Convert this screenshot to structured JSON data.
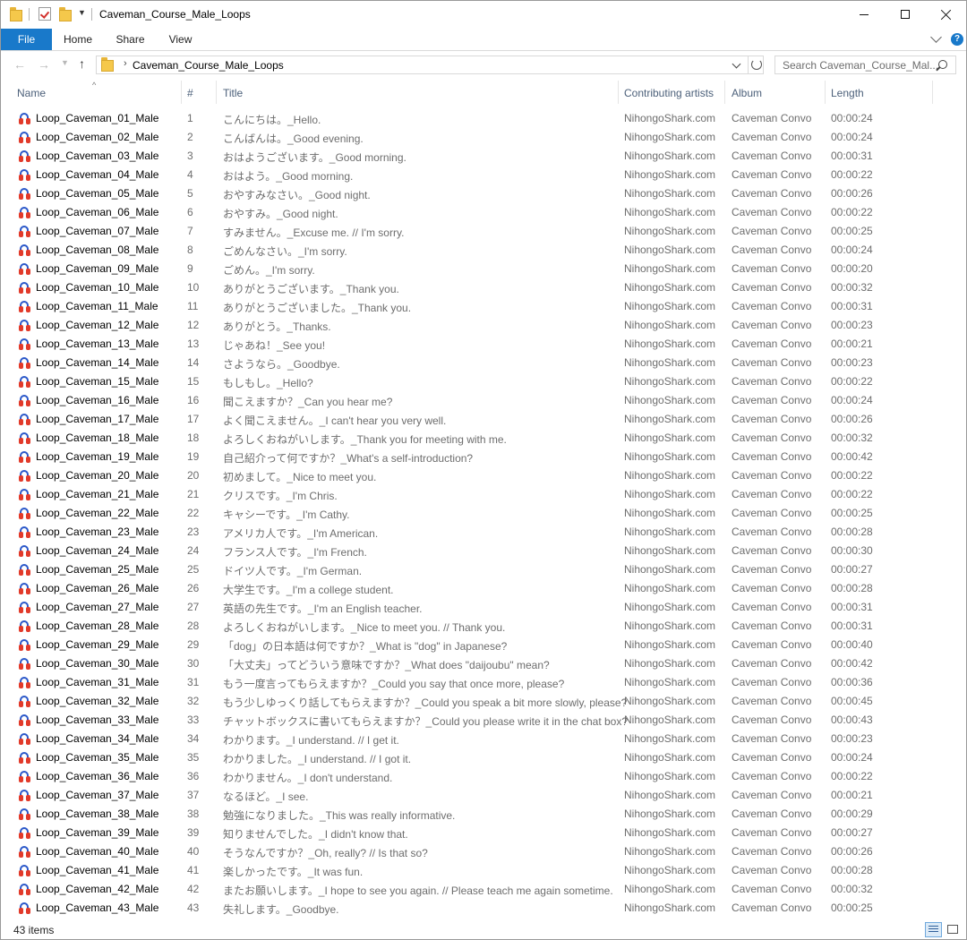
{
  "window": {
    "title": "Caveman_Course_Male_Loops"
  },
  "ribbon": {
    "tabs": [
      "File",
      "Home",
      "Share",
      "View"
    ]
  },
  "address": {
    "path": "Caveman_Course_Male_Loops",
    "search_placeholder": "Search Caveman_Course_Mal..."
  },
  "columns": {
    "name": "Name",
    "number": "#",
    "title": "Title",
    "artists": "Contributing artists",
    "album": "Album",
    "length": "Length"
  },
  "files": [
    {
      "name": "Loop_Caveman_01_Male",
      "num": "1",
      "title": "こんにちは。_Hello.",
      "artist": "NihongoShark.com",
      "album": "Caveman Convo",
      "length": "00:00:24"
    },
    {
      "name": "Loop_Caveman_02_Male",
      "num": "2",
      "title": "こんばんは。_Good evening.",
      "artist": "NihongoShark.com",
      "album": "Caveman Convo",
      "length": "00:00:24"
    },
    {
      "name": "Loop_Caveman_03_Male",
      "num": "3",
      "title": "おはようございます。_Good morning.",
      "artist": "NihongoShark.com",
      "album": "Caveman Convo",
      "length": "00:00:31"
    },
    {
      "name": "Loop_Caveman_04_Male",
      "num": "4",
      "title": "おはよう。_Good morning.",
      "artist": "NihongoShark.com",
      "album": "Caveman Convo",
      "length": "00:00:22"
    },
    {
      "name": "Loop_Caveman_05_Male",
      "num": "5",
      "title": "おやすみなさい。_Good night.",
      "artist": "NihongoShark.com",
      "album": "Caveman Convo",
      "length": "00:00:26"
    },
    {
      "name": "Loop_Caveman_06_Male",
      "num": "6",
      "title": "おやすみ。_Good night.",
      "artist": "NihongoShark.com",
      "album": "Caveman Convo",
      "length": "00:00:22"
    },
    {
      "name": "Loop_Caveman_07_Male",
      "num": "7",
      "title": "すみません。_Excuse me. // I'm sorry.",
      "artist": "NihongoShark.com",
      "album": "Caveman Convo",
      "length": "00:00:25"
    },
    {
      "name": "Loop_Caveman_08_Male",
      "num": "8",
      "title": "ごめんなさい。_I'm sorry.",
      "artist": "NihongoShark.com",
      "album": "Caveman Convo",
      "length": "00:00:24"
    },
    {
      "name": "Loop_Caveman_09_Male",
      "num": "9",
      "title": "ごめん。_I'm sorry.",
      "artist": "NihongoShark.com",
      "album": "Caveman Convo",
      "length": "00:00:20"
    },
    {
      "name": "Loop_Caveman_10_Male",
      "num": "10",
      "title": "ありがとうございます。_Thank you.",
      "artist": "NihongoShark.com",
      "album": "Caveman Convo",
      "length": "00:00:32"
    },
    {
      "name": "Loop_Caveman_11_Male",
      "num": "11",
      "title": "ありがとうございました。_Thank you.",
      "artist": "NihongoShark.com",
      "album": "Caveman Convo",
      "length": "00:00:31"
    },
    {
      "name": "Loop_Caveman_12_Male",
      "num": "12",
      "title": "ありがとう。_Thanks.",
      "artist": "NihongoShark.com",
      "album": "Caveman Convo",
      "length": "00:00:23"
    },
    {
      "name": "Loop_Caveman_13_Male",
      "num": "13",
      "title": "じゃあね！_See you!",
      "artist": "NihongoShark.com",
      "album": "Caveman Convo",
      "length": "00:00:21"
    },
    {
      "name": "Loop_Caveman_14_Male",
      "num": "14",
      "title": "さようなら。_Goodbye.",
      "artist": "NihongoShark.com",
      "album": "Caveman Convo",
      "length": "00:00:23"
    },
    {
      "name": "Loop_Caveman_15_Male",
      "num": "15",
      "title": "もしもし。_Hello?",
      "artist": "NihongoShark.com",
      "album": "Caveman Convo",
      "length": "00:00:22"
    },
    {
      "name": "Loop_Caveman_16_Male",
      "num": "16",
      "title": "聞こえますか？_Can you hear me?",
      "artist": "NihongoShark.com",
      "album": "Caveman Convo",
      "length": "00:00:24"
    },
    {
      "name": "Loop_Caveman_17_Male",
      "num": "17",
      "title": "よく聞こえません。_I can't hear you very well.",
      "artist": "NihongoShark.com",
      "album": "Caveman Convo",
      "length": "00:00:26"
    },
    {
      "name": "Loop_Caveman_18_Male",
      "num": "18",
      "title": "よろしくおねがいします。_Thank you for meeting with me.",
      "artist": "NihongoShark.com",
      "album": "Caveman Convo",
      "length": "00:00:32"
    },
    {
      "name": "Loop_Caveman_19_Male",
      "num": "19",
      "title": "自己紹介って何ですか？_What's a self-introduction?",
      "artist": "NihongoShark.com",
      "album": "Caveman Convo",
      "length": "00:00:42"
    },
    {
      "name": "Loop_Caveman_20_Male",
      "num": "20",
      "title": "初めまして。_Nice to meet you.",
      "artist": "NihongoShark.com",
      "album": "Caveman Convo",
      "length": "00:00:22"
    },
    {
      "name": "Loop_Caveman_21_Male",
      "num": "21",
      "title": "クリスです。_I'm Chris.",
      "artist": "NihongoShark.com",
      "album": "Caveman Convo",
      "length": "00:00:22"
    },
    {
      "name": "Loop_Caveman_22_Male",
      "num": "22",
      "title": "キャシーです。_I'm Cathy.",
      "artist": "NihongoShark.com",
      "album": "Caveman Convo",
      "length": "00:00:25"
    },
    {
      "name": "Loop_Caveman_23_Male",
      "num": "23",
      "title": "アメリカ人です。_I'm American.",
      "artist": "NihongoShark.com",
      "album": "Caveman Convo",
      "length": "00:00:28"
    },
    {
      "name": "Loop_Caveman_24_Male",
      "num": "24",
      "title": "フランス人です。_I'm French.",
      "artist": "NihongoShark.com",
      "album": "Caveman Convo",
      "length": "00:00:30"
    },
    {
      "name": "Loop_Caveman_25_Male",
      "num": "25",
      "title": "ドイツ人です。_I'm German.",
      "artist": "NihongoShark.com",
      "album": "Caveman Convo",
      "length": "00:00:27"
    },
    {
      "name": "Loop_Caveman_26_Male",
      "num": "26",
      "title": "大学生です。_I'm a college student.",
      "artist": "NihongoShark.com",
      "album": "Caveman Convo",
      "length": "00:00:28"
    },
    {
      "name": "Loop_Caveman_27_Male",
      "num": "27",
      "title": "英語の先生です。_I'm an English teacher.",
      "artist": "NihongoShark.com",
      "album": "Caveman Convo",
      "length": "00:00:31"
    },
    {
      "name": "Loop_Caveman_28_Male",
      "num": "28",
      "title": "よろしくおねがいします。_Nice to meet you. // Thank you.",
      "artist": "NihongoShark.com",
      "album": "Caveman Convo",
      "length": "00:00:31"
    },
    {
      "name": "Loop_Caveman_29_Male",
      "num": "29",
      "title": "「dog」の日本語は何ですか？_What is \"dog\" in Japanese?",
      "artist": "NihongoShark.com",
      "album": "Caveman Convo",
      "length": "00:00:40"
    },
    {
      "name": "Loop_Caveman_30_Male",
      "num": "30",
      "title": "「大丈夫」ってどういう意味ですか？_What does \"daijoubu\" mean?",
      "artist": "NihongoShark.com",
      "album": "Caveman Convo",
      "length": "00:00:42"
    },
    {
      "name": "Loop_Caveman_31_Male",
      "num": "31",
      "title": "もう一度言ってもらえますか？_Could you say that once more, please?",
      "artist": "NihongoShark.com",
      "album": "Caveman Convo",
      "length": "00:00:36"
    },
    {
      "name": "Loop_Caveman_32_Male",
      "num": "32",
      "title": "もう少しゆっくり話してもらえますか？_Could you speak a bit more slowly, please?",
      "artist": "NihongoShark.com",
      "album": "Caveman Convo",
      "length": "00:00:45"
    },
    {
      "name": "Loop_Caveman_33_Male",
      "num": "33",
      "title": "チャットボックスに書いてもらえますか？_Could you please write it in the chat box?",
      "artist": "NihongoShark.com",
      "album": "Caveman Convo",
      "length": "00:00:43"
    },
    {
      "name": "Loop_Caveman_34_Male",
      "num": "34",
      "title": "わかります。_I understand. // I get it.",
      "artist": "NihongoShark.com",
      "album": "Caveman Convo",
      "length": "00:00:23"
    },
    {
      "name": "Loop_Caveman_35_Male",
      "num": "35",
      "title": "わかりました。_I understand. // I got it.",
      "artist": "NihongoShark.com",
      "album": "Caveman Convo",
      "length": "00:00:24"
    },
    {
      "name": "Loop_Caveman_36_Male",
      "num": "36",
      "title": "わかりません。_I don't understand.",
      "artist": "NihongoShark.com",
      "album": "Caveman Convo",
      "length": "00:00:22"
    },
    {
      "name": "Loop_Caveman_37_Male",
      "num": "37",
      "title": "なるほど。_I see.",
      "artist": "NihongoShark.com",
      "album": "Caveman Convo",
      "length": "00:00:21"
    },
    {
      "name": "Loop_Caveman_38_Male",
      "num": "38",
      "title": "勉強になりました。_This was really informative.",
      "artist": "NihongoShark.com",
      "album": "Caveman Convo",
      "length": "00:00:29"
    },
    {
      "name": "Loop_Caveman_39_Male",
      "num": "39",
      "title": "知りませんでした。_I didn't know that.",
      "artist": "NihongoShark.com",
      "album": "Caveman Convo",
      "length": "00:00:27"
    },
    {
      "name": "Loop_Caveman_40_Male",
      "num": "40",
      "title": "そうなんですか？_Oh, really? // Is that so?",
      "artist": "NihongoShark.com",
      "album": "Caveman Convo",
      "length": "00:00:26"
    },
    {
      "name": "Loop_Caveman_41_Male",
      "num": "41",
      "title": "楽しかったです。_It was fun.",
      "artist": "NihongoShark.com",
      "album": "Caveman Convo",
      "length": "00:00:28"
    },
    {
      "name": "Loop_Caveman_42_Male",
      "num": "42",
      "title": "またお願いします。_I hope to see you again. // Please teach me again sometime.",
      "artist": "NihongoShark.com",
      "album": "Caveman Convo",
      "length": "00:00:32"
    },
    {
      "name": "Loop_Caveman_43_Male",
      "num": "43",
      "title": "失礼します。_Goodbye.",
      "artist": "NihongoShark.com",
      "album": "Caveman Convo",
      "length": "00:00:25"
    }
  ],
  "status": {
    "item_count": "43 items"
  },
  "colors": {
    "accent": "#1979ca",
    "header_text": "#4c607a",
    "secondary_text": "#6d6d6d"
  },
  "icons": {
    "file": "audio-file-icon",
    "folder": "folder-icon"
  }
}
